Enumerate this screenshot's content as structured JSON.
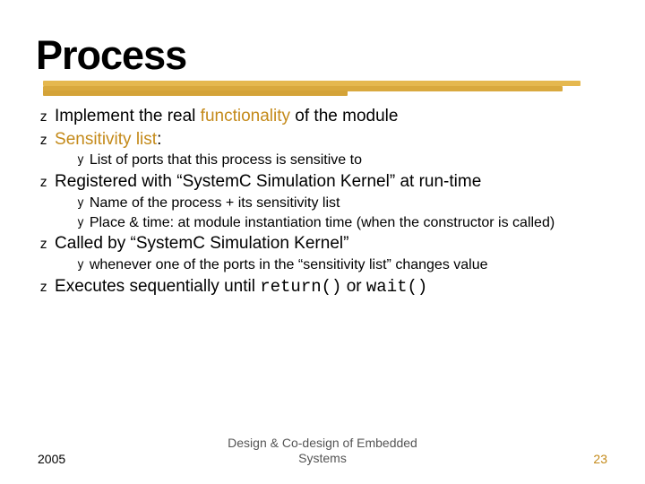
{
  "title": "Process",
  "bullets": {
    "b1": {
      "pre": "Implement the real ",
      "hl": "functionality",
      "post": " of the module"
    },
    "b2": {
      "hl": "Sensitivity list",
      "post": ":"
    },
    "b2s1": "List of ports that this process is sensitive to",
    "b3": "Registered with “SystemC Simulation Kernel” at run-time",
    "b3s1": "Name of the process + its sensitivity list",
    "b3s2": "Place & time: at module instantiation time (when the constructor is called)",
    "b4": "Called by “SystemC Simulation Kernel”",
    "b4s1": "whenever one of the ports in the “sensitivity list” changes value",
    "b5": {
      "pre": "Executes sequentially until ",
      "code1": "return()",
      "mid": " or ",
      "code2": "wait()"
    }
  },
  "glyph": {
    "l1": "z",
    "l2": "y"
  },
  "footer": {
    "year": "2005",
    "center": "Design & Co-design of Embedded\nSystems",
    "page": "23"
  }
}
